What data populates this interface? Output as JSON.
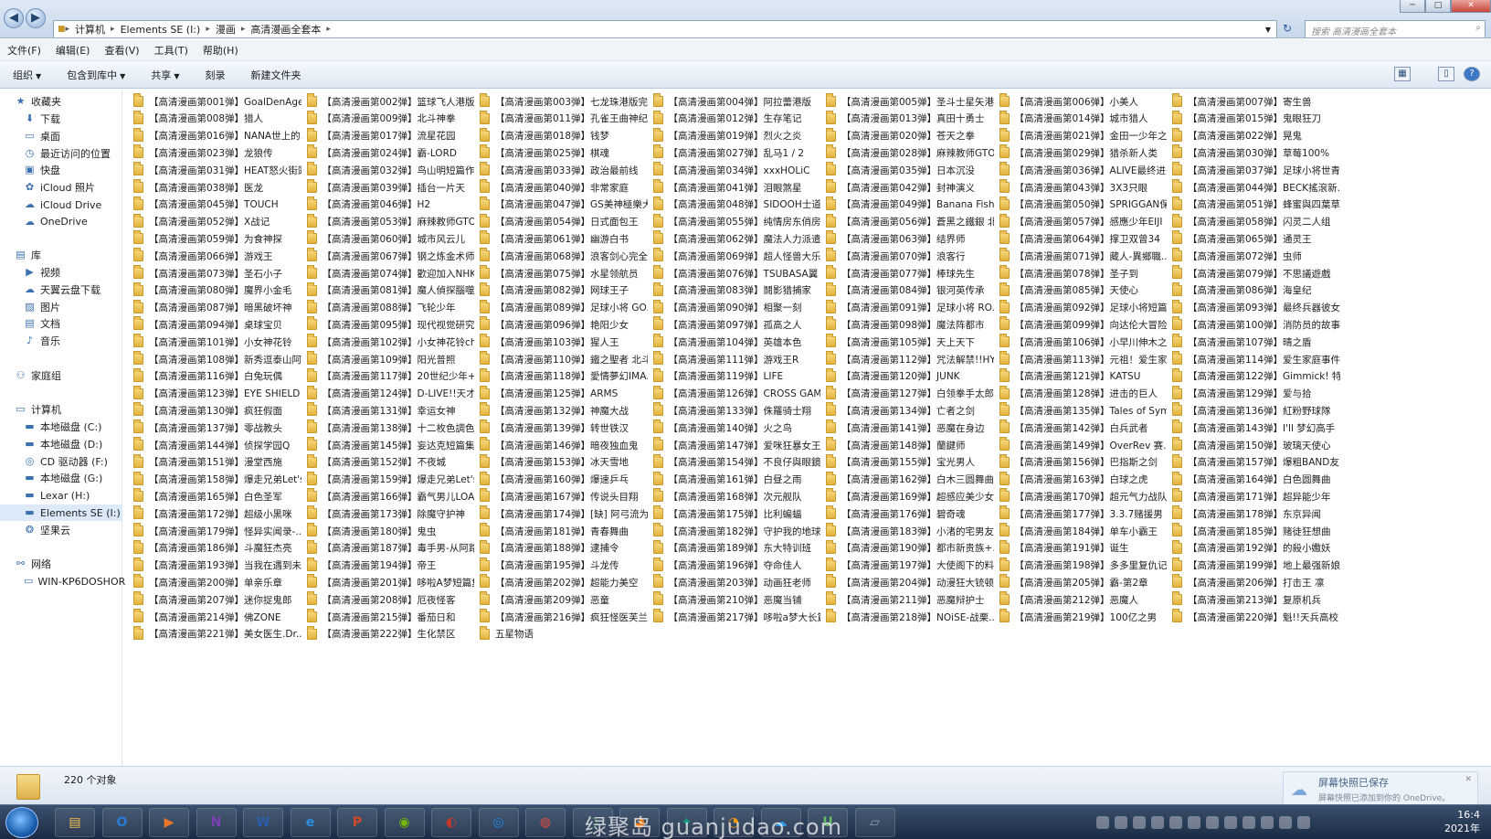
{
  "window": {
    "breadcrumb": [
      "计算机",
      "Elements SE (I:)",
      "漫画",
      "高清漫画全套本"
    ],
    "search_placeholder": "搜索 高清漫画全套本"
  },
  "menu": [
    "文件(F)",
    "编辑(E)",
    "查看(V)",
    "工具(T)",
    "帮助(H)"
  ],
  "toolbar": {
    "organize": "组织",
    "include_library": "包含到库中",
    "share": "共享",
    "burn": "刻录",
    "new_folder": "新建文件夹"
  },
  "nav": {
    "favorites": "收藏夹",
    "fav_items": [
      "下载",
      "桌面",
      "最近访问的位置",
      "快盘",
      "iCloud 照片",
      "iCloud Drive",
      "OneDrive"
    ],
    "libraries": "库",
    "lib_items": [
      "视频",
      "天翼云盘下载",
      "图片",
      "文档",
      "音乐"
    ],
    "homegroup": "家庭组",
    "computer": "计算机",
    "comp_items": [
      "本地磁盘 (C:)",
      "本地磁盘 (D:)",
      "CD 驱动器 (F:)",
      "本地磁盘 (G:)",
      "Lexar (H:)",
      "Elements SE (I:)",
      "坚果云"
    ],
    "network": "网络",
    "net_items": [
      "WIN-KP6DOSHOR"
    ]
  },
  "files": [
    "【高清漫画第001弹】GoalDenAge...",
    "【高清漫画第002弹】篮球飞人港版...",
    "【高清漫画第003弹】七龙珠港版完...",
    "【高清漫画第004弹】阿拉蕾港版",
    "【高清漫画第005弹】圣斗士星矢港...",
    "【高清漫画第006弹】小美人",
    "【高清漫画第007弹】寄生兽",
    "【高清漫画第008弹】猎人",
    "【高清漫画第009弹】北斗神拳",
    "【高清漫画第011弹】孔雀王曲神纪",
    "【高清漫画第012弹】生存笔记",
    "【高清漫画第013弹】真田十勇士",
    "【高清漫画第014弹】城市猎人",
    "【高清漫画第015弹】鬼眼狂刀",
    "【高清漫画第016弹】NANA世上的...",
    "【高清漫画第017弹】流星花园",
    "【高清漫画第018弹】钱梦",
    "【高清漫画第019弹】烈火之炎",
    "【高清漫画第020弹】苍天之拳",
    "【高清漫画第021弹】金田一少年之...",
    "【高清漫画第022弹】晃鬼",
    "【高清漫画第023弹】龙狼传",
    "【高清漫画第024弹】霸-LORD",
    "【高清漫画第025弹】棋魂",
    "【高清漫画第027弹】乱马1 / 2",
    "【高清漫画第028弹】麻辣教师GTO",
    "【高清漫画第029弹】猎杀新人类",
    "【高清漫画第030弹】草莓100%",
    "【高清漫画第031弹】HEAT怒火街頭",
    "【高清漫画第032弹】鸟山明短篇作...",
    "【高清漫画第033弹】政治最前线",
    "【高清漫画第034弹】xxxHOLiC",
    "【高清漫画第035弹】日本沉没",
    "【高清漫画第036弹】ALIVE最终进...",
    "【高清漫画第037弹】足球小将世青篇",
    "【高清漫画第038弹】医龙",
    "【高清漫画第039弹】插台一片天",
    "【高清漫画第040弹】非常家庭",
    "【高清漫画第041弹】泪眼煞星",
    "【高清漫画第042弹】封神演义",
    "【高清漫画第043弹】3X3只眼",
    "【高清漫画第044弹】BECK搖滾新...",
    "【高清漫画第045弹】TOUCH",
    "【高清漫画第046弹】H2",
    "【高清漫画第047弹】GS美神極樂大...",
    "【高清漫画第048弹】SIDOOH士道",
    "【高清漫画第049弹】Banana Fish ...",
    "【高清漫画第050弹】SPRIGGAN保...",
    "【高清漫画第051弹】蜂蜜與四葉草",
    "【高清漫画第052弹】X战记",
    "【高清漫画第053弹】麻辣教师GTO",
    "【高清漫画第054弹】日式面包王",
    "【高清漫画第055弹】纯情房东俏房客",
    "【高清漫画第056弹】蒼黑之鐵銀 北...",
    "【高清漫画第057弹】感應少年EIJI",
    "【高清漫画第058弹】闪灵二人组",
    "【高清漫画第059弹】为食神探",
    "【高清漫画第060弹】城市风云儿",
    "【高清漫画第061弹】幽游白书",
    "【高清漫画第062弹】魔法人力派遣...",
    "【高清漫画第063弹】结界师",
    "【高清漫画第064弹】撑卫双曾34",
    "【高清漫画第065弹】通灵王",
    "【高清漫画第066弹】游戏王",
    "【高清漫画第067弹】钢之炼金术师",
    "【高清漫画第068弹】浪客剑心完全版",
    "【高清漫画第069弹】超人怪兽大乐园",
    "【高清漫画第070弹】浪客行",
    "【高清漫画第071弹】藏人-異鄉職...",
    "【高清漫画第072弹】虫师",
    "【高清漫画第073弹】圣石小子",
    "【高清漫画第074弹】歡迎加入NHK",
    "【高清漫画第075弹】水星领航员",
    "【高清漫画第076弹】TSUBASA翼",
    "【高清漫画第077弹】棒球先生",
    "【高清漫画第078弹】圣子到",
    "【高清漫画第079弹】不思議遊戲",
    "【高清漫画第080弹】魔界小金毛",
    "【高清漫画第081弹】魔人偵探腦噬...",
    "【高清漫画第082弹】网球王子",
    "【高清漫画第083弹】鬪影猎捕家",
    "【高清漫画第084弹】银河英传承",
    "【高清漫画第085弹】天使心",
    "【高清漫画第086弹】海皇纪",
    "【高清漫画第087弹】暗黑破坏神",
    "【高清漫画第088弹】飞轮少年",
    "【高清漫画第089弹】足球小将 GO...",
    "【高清漫画第090弹】相聚一刻",
    "【高清漫画第091弹】足球小将 RO...",
    "【高清漫画第092弹】足球小将短篇集",
    "【高清漫画第093弹】最终兵器彼女",
    "【高清漫画第094弹】桌球宝贝",
    "【高清漫画第095弹】现代视觉研究会",
    "【高清漫画第096弹】艳阳少女",
    "【高清漫画第097弹】孤高之人",
    "【高清漫画第098弹】魔法阵都市",
    "【高清漫画第099弹】向达伦大冒险",
    "【高清漫画第100弹】消防员的故事",
    "【高清漫画第101弹】小女神花铃",
    "【高清漫画第102弹】小女神花铃chu",
    "【高清漫画第103弹】猩人王",
    "【高清漫画第104弹】英雄本色",
    "【高清漫画第105弹】天上天下",
    "【高清漫画第106弹】小早川伸木之恋",
    "【高清漫画第107弹】晴之盾",
    "【高清漫画第108弹】新秀逗泰山阿達",
    "【高清漫画第109弹】阳光普照",
    "【高清漫画第110弹】鐵之聖者 北斗...",
    "【高清漫画第111弹】游戏王R",
    "【高清漫画第112弹】咒法解禁!!HY...",
    "【高清漫画第113弹】元祖！爱生家...",
    "【高清漫画第114弹】爱生家庭事件",
    "【高清漫画第116弹】白兔玩偶",
    "【高清漫画第117弹】20世纪少年+...",
    "【高清漫画第118弹】愛情夢幻IMA...",
    "【高清漫画第119弹】LIFE",
    "【高清漫画第120弹】JUNK",
    "【高清漫画第121弹】KATSU",
    "【高清漫画第122弹】Gimmick! 特...",
    "【高清漫画第123弹】EYE SHIELD ...",
    "【高清漫画第124弹】D-LIVE!!天才...",
    "【高清漫画第125弹】ARMS",
    "【高清漫画第126弹】CROSS GAME",
    "【高清漫画第127弹】白领拳手太郎",
    "【高清漫画第128弹】进击的巨人",
    "【高清漫画第129弹】爱与拾",
    "【高清漫画第130弹】疯狂假面",
    "【高清漫画第131弹】幸运女神",
    "【高清漫画第132弹】神魔大战",
    "【高清漫画第133弹】侏羅骑士翔",
    "【高清漫画第134弹】亡者之剑",
    "【高清漫画第135弹】Tales of Sym...",
    "【高清漫画第136弹】紅粉野球隊",
    "【高清漫画第137弹】零战教头",
    "【高清漫画第138弹】十二枚色調色盤",
    "【高清漫画第139弹】转世铁汉",
    "【高清漫画第140弹】火之鸟",
    "【高清漫画第141弹】恶魔在身边",
    "【高清漫画第142弹】白兵武者",
    "【高清漫画第143弹】I'll 梦幻高手",
    "【高清漫画第144弹】侦探学园Q",
    "【高清漫画第145弹】妄达克短篇集",
    "【高清漫画第146弹】暗夜独血鬼",
    "【高清漫画第147弹】爱咪狂暴女王",
    "【高清漫画第148弹】蘭鍵师",
    "【高清漫画第149弹】OverRev 赛...",
    "【高清漫画第150弹】玻璃天使心",
    "【高清漫画第151弹】漫堂西施",
    "【高清漫画第152弹】不夜城",
    "【高清漫画第153弹】冰天雪地",
    "【高清漫画第154弹】不良仔與眼鏡妹",
    "【高清漫画第155弹】宝光男人",
    "【高清漫画第156弹】巴指斯之剑",
    "【高清漫画第157弹】爆粗BAND友",
    "【高清漫画第158弹】爆走兄弟Let's...",
    "【高清漫画第159弹】爆走兄弟Let's...",
    "【高清漫画第160弹】爆速乒乓",
    "【高清漫画第161弹】白昼之雨",
    "【高清漫画第162弹】白木三圆舞曲",
    "【高清漫画第163弹】白球之虎",
    "【高清漫画第164弹】白色圆舞曲",
    "【高清漫画第165弹】白色圣军",
    "【高清漫画第166弹】霸气男儿LOAD...",
    "【高清漫画第167弹】传说头目翔",
    "【高清漫画第168弹】次元舰队",
    "【高清漫画第169弹】超感应美少女",
    "【高清漫画第170弹】超元气力战队",
    "【高清漫画第171弹】超异能少年",
    "【高清漫画第172弹】超级小黑咪",
    "【高清漫画第173弹】除魔守护神",
    "【高清漫画第174弹】[缺] 阿弓流为I...",
    "【高清漫画第175弹】比利蝙蝠",
    "【高清漫画第176弹】碧奇魂",
    "【高清漫画第177弹】3.3.7赌援男",
    "【高清漫画第178弹】东京异闻",
    "【高清漫画第179弹】怪异实闻录-...",
    "【高清漫画第180弹】鬼虫",
    "【高清漫画第181弹】青春舞曲",
    "【高清漫画第182弹】守护我的地球",
    "【高清漫画第183弹】小渚的宅男友",
    "【高清漫画第184弹】单车小霸王",
    "【高清漫画第185弹】赌徒狂想曲",
    "【高清漫画第186弹】斗魔狂杰亮",
    "【高清漫画第187弹】毒手男-从阿路...",
    "【高清漫画第188弹】逮捕令",
    "【高清漫画第189弹】东大特训班",
    "【高清漫画第190弹】都市新贵族+...",
    "【高清漫画第191弹】诞生",
    "【高清漫画第192弹】的殺小嫐妖",
    "【高清漫画第193弹】当我在遇到未来",
    "【高清漫画第194弹】帝王",
    "【高清漫画第195弹】斗龙传",
    "【高清漫画第196弹】夺命佳人",
    "【高清漫画第197弹】大使阁下的料...",
    "【高清漫画第198弹】多多里复仇记",
    "【高清漫画第199弹】地上最强新娘",
    "【高清漫画第200弹】单亲乐章",
    "【高清漫画第201弹】哆啦A梦短篇集",
    "【高清漫画第202弹】超能力美空",
    "【高清漫画第203弹】动画狂老师",
    "【高清漫画第204弹】动漫狂大铳顿",
    "【高清漫画第205弹】霸-第2章",
    "【高清漫画第206弹】打击王 凛",
    "【高清漫画第207弹】迷你捉鬼郎",
    "【高清漫画第208弹】厄夜怪客",
    "【高清漫画第209弹】恶童",
    "【高清漫画第210弹】恶魔当铺",
    "【高清漫画第211弹】恶魔辩护士",
    "【高清漫画第212弹】恶魔人",
    "【高清漫画第213弹】复原机兵",
    "【高清漫画第214弹】佛ZONE",
    "【高清漫画第215弹】番茄日和",
    "【高清漫画第216弹】疯狂怪医芙兰",
    "【高清漫画第217弹】哆啦a梦大长篇",
    "【高清漫画第218弹】NOiSE-战栗...",
    "【高清漫画第219弹】100亿之男",
    "【高清漫画第220弹】魁!!天兵高校",
    "【高清漫画第221弹】美女医生.Dr....",
    "【高清漫画第222弹】生化禁区",
    "五星物语"
  ],
  "status": {
    "count": "220 个对象",
    "toast_title": "屏幕快照已保存",
    "toast_body": "屏幕快照已添加到你的 OneDrive。"
  },
  "taskbar": {
    "apps": [
      "explorer",
      "outlook",
      "media-player",
      "onenote",
      "word",
      "ie",
      "powerpoint",
      "nvidia",
      "app-dark",
      "edge-beta",
      "chrome",
      "app-green",
      "app-rainbow",
      "app-colorful",
      "app-orange",
      "app-cloud",
      "app-u",
      "app-folder"
    ],
    "watermark": "绿聚岛 guanjudao.com",
    "time": "16:4",
    "date": "2021年"
  }
}
